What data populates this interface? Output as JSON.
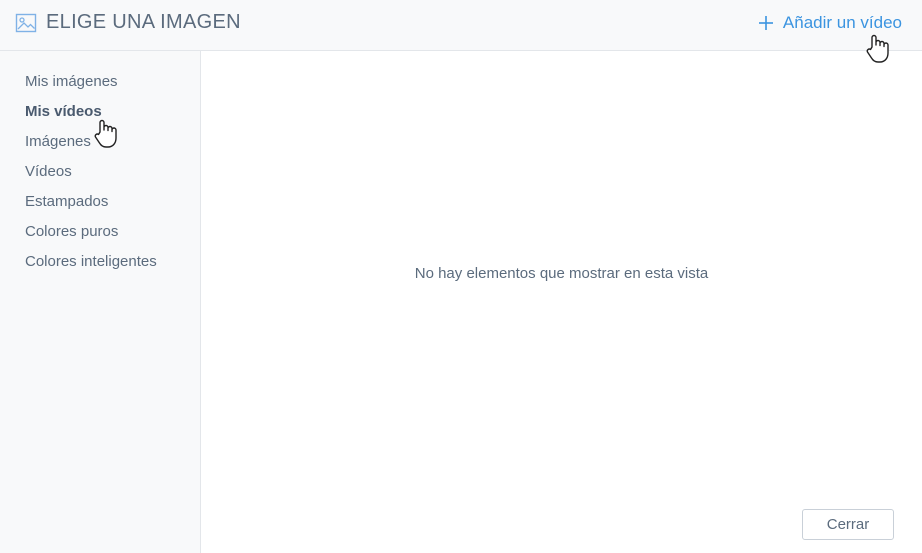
{
  "header": {
    "title": "ELIGE UNA IMAGEN",
    "title_icon": "image-icon",
    "add_label": "Añadir un vídeo",
    "add_icon": "plus-icon"
  },
  "sidebar": {
    "items": [
      {
        "label": "Mis imágenes",
        "active": false
      },
      {
        "label": "Mis vídeos",
        "active": true
      },
      {
        "label": "Imágenes",
        "active": false
      },
      {
        "label": "Vídeos",
        "active": false
      },
      {
        "label": "Estampados",
        "active": false
      },
      {
        "label": "Colores puros",
        "active": false
      },
      {
        "label": "Colores inteligentes",
        "active": false
      }
    ]
  },
  "main": {
    "empty_message": "No hay elementos que mostrar en esta vista",
    "close_label": "Cerrar"
  },
  "colors": {
    "accent": "#3b94e0",
    "text": "#5b6b7d",
    "panel_bg": "#f8f9fa",
    "border": "#e3e6ea"
  }
}
